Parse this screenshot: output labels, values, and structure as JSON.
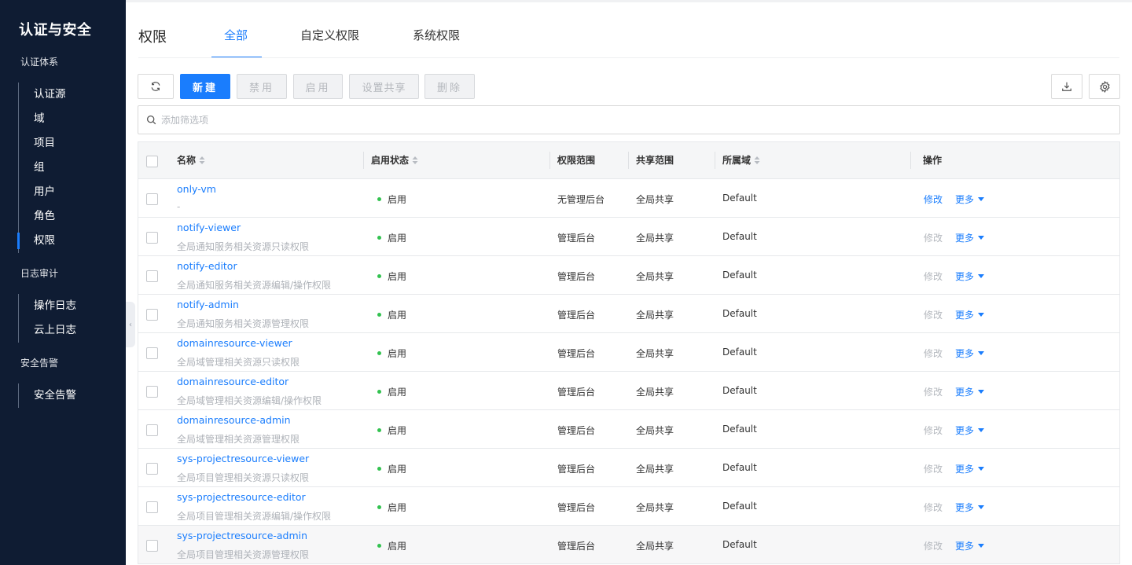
{
  "sidebar": {
    "title": "认证与安全",
    "groups": [
      {
        "title": "认证体系",
        "items": [
          {
            "label": "认证源"
          },
          {
            "label": "域"
          },
          {
            "label": "项目"
          },
          {
            "label": "组"
          },
          {
            "label": "用户"
          },
          {
            "label": "角色"
          },
          {
            "label": "权限",
            "active": true
          }
        ]
      },
      {
        "title": "日志审计",
        "items": [
          {
            "label": "操作日志"
          },
          {
            "label": "云上日志"
          }
        ]
      },
      {
        "title": "安全告警",
        "items": [
          {
            "label": "安全告警"
          }
        ]
      }
    ]
  },
  "header": {
    "title": "权限",
    "tabs": [
      {
        "label": "全部",
        "active": true
      },
      {
        "label": "自定义权限"
      },
      {
        "label": "系统权限"
      }
    ]
  },
  "toolbar": {
    "refresh_icon": "refresh-icon",
    "new_label": "新建",
    "disable_label": "禁用",
    "enable_label": "启用",
    "share_label": "设置共享",
    "delete_label": "删除",
    "download_icon": "download-icon",
    "settings_icon": "gear-icon"
  },
  "search": {
    "placeholder": "添加筛选项",
    "value": ""
  },
  "table": {
    "columns": {
      "name": "名称",
      "status": "启用状态",
      "scope": "权限范围",
      "share": "共享范围",
      "domain": "所属域",
      "ops": "操作"
    },
    "edit_label": "修改",
    "more_label": "更多",
    "rows": [
      {
        "name": "only-vm",
        "desc": "-",
        "status": "启用",
        "scope": "无管理后台",
        "share": "全局共享",
        "domain": "Default",
        "editable": true
      },
      {
        "name": "notify-viewer",
        "desc": "全局通知服务相关资源只读权限",
        "status": "启用",
        "scope": "管理后台",
        "share": "全局共享",
        "domain": "Default",
        "editable": false
      },
      {
        "name": "notify-editor",
        "desc": "全局通知服务相关资源编辑/操作权限",
        "status": "启用",
        "scope": "管理后台",
        "share": "全局共享",
        "domain": "Default",
        "editable": false
      },
      {
        "name": "notify-admin",
        "desc": "全局通知服务相关资源管理权限",
        "status": "启用",
        "scope": "管理后台",
        "share": "全局共享",
        "domain": "Default",
        "editable": false
      },
      {
        "name": "domainresource-viewer",
        "desc": "全局域管理相关资源只读权限",
        "status": "启用",
        "scope": "管理后台",
        "share": "全局共享",
        "domain": "Default",
        "editable": false
      },
      {
        "name": "domainresource-editor",
        "desc": "全局域管理相关资源编辑/操作权限",
        "status": "启用",
        "scope": "管理后台",
        "share": "全局共享",
        "domain": "Default",
        "editable": false
      },
      {
        "name": "domainresource-admin",
        "desc": "全局域管理相关资源管理权限",
        "status": "启用",
        "scope": "管理后台",
        "share": "全局共享",
        "domain": "Default",
        "editable": false
      },
      {
        "name": "sys-projectresource-viewer",
        "desc": "全局项目管理相关资源只读权限",
        "status": "启用",
        "scope": "管理后台",
        "share": "全局共享",
        "domain": "Default",
        "editable": false
      },
      {
        "name": "sys-projectresource-editor",
        "desc": "全局项目管理相关资源编辑/操作权限",
        "status": "启用",
        "scope": "管理后台",
        "share": "全局共享",
        "domain": "Default",
        "editable": false
      },
      {
        "name": "sys-projectresource-admin",
        "desc": "全局项目管理相关资源管理权限",
        "status": "启用",
        "scope": "管理后台",
        "share": "全局共享",
        "domain": "Default",
        "editable": false,
        "hover": true
      }
    ]
  },
  "colors": {
    "sidebar_bg": "#0f1c33",
    "accent": "#1a7dfd",
    "status_enabled": "#33c250"
  }
}
